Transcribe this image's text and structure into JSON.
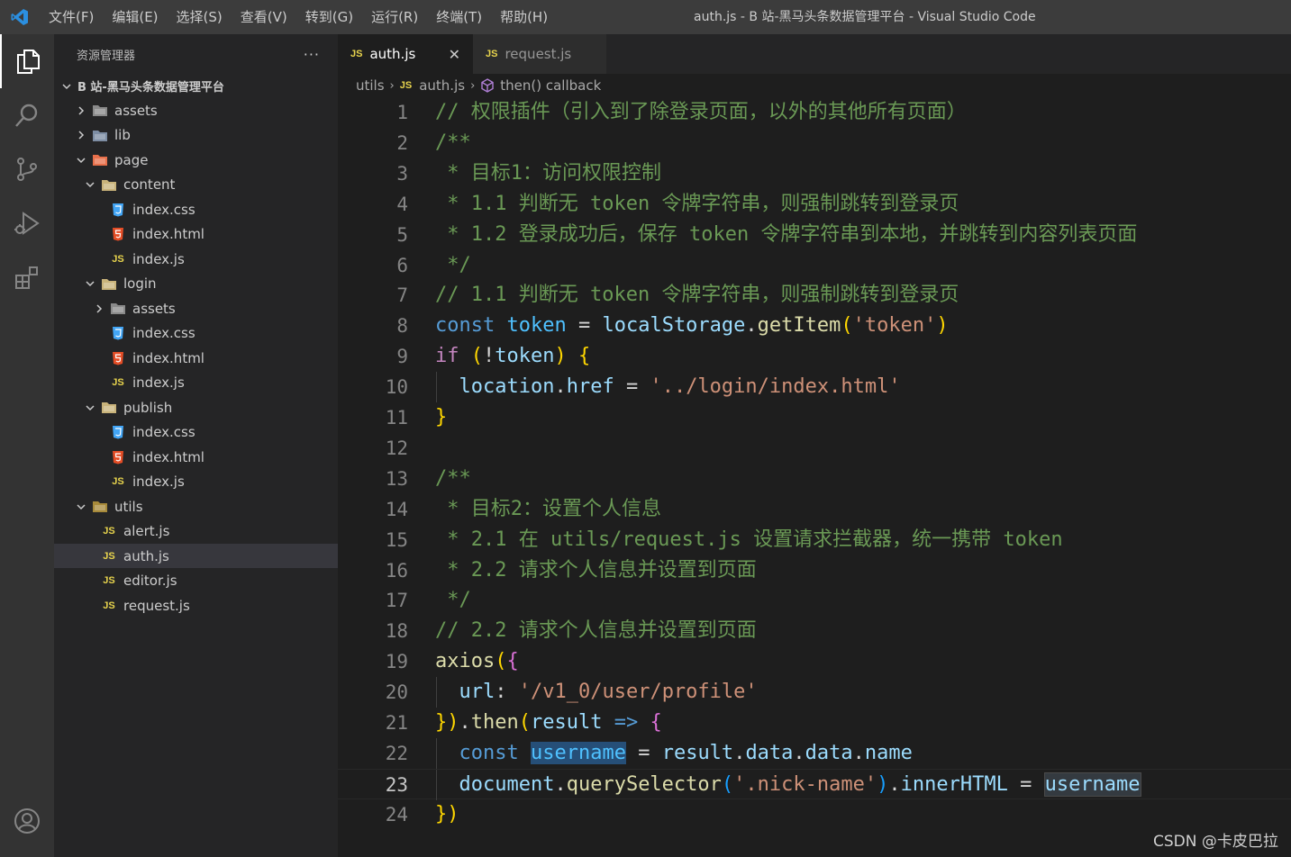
{
  "titlebar": {
    "menu": [
      "文件(F)",
      "编辑(E)",
      "选择(S)",
      "查看(V)",
      "转到(G)",
      "运行(R)",
      "终端(T)",
      "帮助(H)"
    ],
    "title": "auth.js - B 站-黑马头条数据管理平台 - Visual Studio Code"
  },
  "activity_bar": {
    "items": [
      "explorer-icon",
      "search-icon",
      "source-control-icon",
      "run-debug-icon",
      "extensions-icon"
    ],
    "bottom": "account-icon"
  },
  "sidebar": {
    "title": "资源管理器",
    "more": "···",
    "root": "B 站-黑马头条数据管理平台",
    "tree": [
      {
        "label": "assets",
        "type": "folder",
        "expanded": false
      },
      {
        "label": "lib",
        "type": "folder",
        "expanded": false
      },
      {
        "label": "page",
        "type": "folder",
        "expanded": true
      },
      {
        "label": "content",
        "type": "folder",
        "expanded": true
      },
      {
        "label": "index.css",
        "type": "css"
      },
      {
        "label": "index.html",
        "type": "html"
      },
      {
        "label": "index.js",
        "type": "js"
      },
      {
        "label": "login",
        "type": "folder",
        "expanded": true
      },
      {
        "label": "assets",
        "type": "folder",
        "expanded": false
      },
      {
        "label": "index.css",
        "type": "css"
      },
      {
        "label": "index.html",
        "type": "html"
      },
      {
        "label": "index.js",
        "type": "js"
      },
      {
        "label": "publish",
        "type": "folder",
        "expanded": true
      },
      {
        "label": "index.css",
        "type": "css"
      },
      {
        "label": "index.html",
        "type": "html"
      },
      {
        "label": "index.js",
        "type": "js"
      },
      {
        "label": "utils",
        "type": "folder",
        "expanded": true
      },
      {
        "label": "alert.js",
        "type": "js"
      },
      {
        "label": "auth.js",
        "type": "js",
        "selected": true
      },
      {
        "label": "editor.js",
        "type": "js"
      },
      {
        "label": "request.js",
        "type": "js"
      }
    ]
  },
  "tabs": [
    {
      "badge": "JS",
      "label": "auth.js",
      "active": true,
      "close": "✕"
    },
    {
      "badge": "JS",
      "label": "request.js",
      "active": false
    }
  ],
  "breadcrumb": {
    "folder": "utils",
    "file_badge": "JS",
    "file": "auth.js",
    "symbol": "then() callback"
  },
  "editor": {
    "current_line": 23,
    "lines": [
      {
        "n": "1",
        "text": "// 权限插件（引入到了除登录页面，以外的其他所有页面）"
      },
      {
        "n": "2",
        "text": "/**"
      },
      {
        "n": "3",
        "text": " * 目标1：访问权限控制"
      },
      {
        "n": "4",
        "text": " * 1.1 判断无 token 令牌字符串，则强制跳转到登录页"
      },
      {
        "n": "5",
        "text": " * 1.2 登录成功后，保存 token 令牌字符串到本地，并跳转到内容列表页面"
      },
      {
        "n": "6",
        "text": " */"
      },
      {
        "n": "7",
        "text": "// 1.1 判断无 token 令牌字符串，则强制跳转到登录页"
      },
      {
        "n": "8",
        "text": "const token = localStorage.getItem('token')"
      },
      {
        "n": "9",
        "text": "if (!token) {"
      },
      {
        "n": "10",
        "text": "  location.href = '../login/index.html'"
      },
      {
        "n": "11",
        "text": "}"
      },
      {
        "n": "12",
        "text": ""
      },
      {
        "n": "13",
        "text": "/**"
      },
      {
        "n": "14",
        "text": " * 目标2：设置个人信息"
      },
      {
        "n": "15",
        "text": " * 2.1 在 utils/request.js 设置请求拦截器，统一携带 token"
      },
      {
        "n": "16",
        "text": " * 2.2 请求个人信息并设置到页面"
      },
      {
        "n": "17",
        "text": " */"
      },
      {
        "n": "18",
        "text": "// 2.2 请求个人信息并设置到页面"
      },
      {
        "n": "19",
        "text": "axios({"
      },
      {
        "n": "20",
        "text": "  url: '/v1_0/user/profile'"
      },
      {
        "n": "21",
        "text": "}).then(result => {"
      },
      {
        "n": "22",
        "text": "  const username = result.data.data.name"
      },
      {
        "n": "23",
        "text": "  document.querySelector('.nick-name').innerHTML = username"
      },
      {
        "n": "24",
        "text": "})"
      }
    ]
  },
  "watermark": "CSDN @卡皮巴拉"
}
